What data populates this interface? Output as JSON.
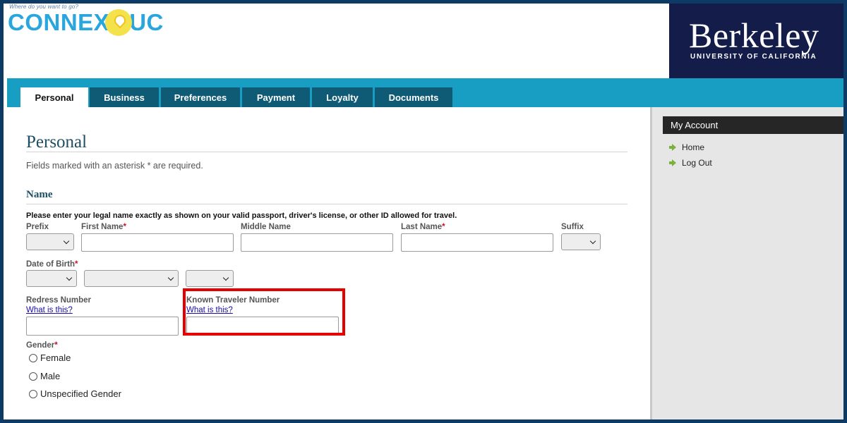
{
  "header": {
    "logo_tagline": "Where do you want to go?",
    "logo_left": "CONNEX",
    "logo_right": "UC",
    "university_name": "Berkeley",
    "university_sub": "UNIVERSITY OF CALIFORNIA"
  },
  "nav": {
    "tabs": [
      {
        "label": "Personal",
        "active": true
      },
      {
        "label": "Business"
      },
      {
        "label": "Preferences"
      },
      {
        "label": "Payment"
      },
      {
        "label": "Loyalty"
      },
      {
        "label": "Documents"
      }
    ]
  },
  "main": {
    "title": "Personal",
    "required_note": "Fields marked with an asterisk * are required.",
    "section_name": "Name",
    "instructions": "Please enter your legal name exactly as shown on your valid passport, driver's license, or other ID allowed for travel.",
    "fields": {
      "prefix": "Prefix",
      "first_name": "First Name",
      "middle_name": "Middle Name",
      "last_name": "Last Name",
      "suffix": "Suffix",
      "dob": "Date of Birth",
      "redress": "Redress Number",
      "ktn": "Known Traveler Number",
      "what_is_this": "What is this?",
      "gender": "Gender"
    },
    "required_mark": "*",
    "gender_options": [
      "Female",
      "Male",
      "Unspecified Gender"
    ]
  },
  "sidebar": {
    "title": "My Account",
    "items": [
      "Home",
      "Log Out"
    ]
  },
  "colors": {
    "nav_bg": "#179ec2",
    "tab_bg": "#0f5a74",
    "highlight": "#e60000",
    "berkeley_bg": "#141d4a"
  }
}
